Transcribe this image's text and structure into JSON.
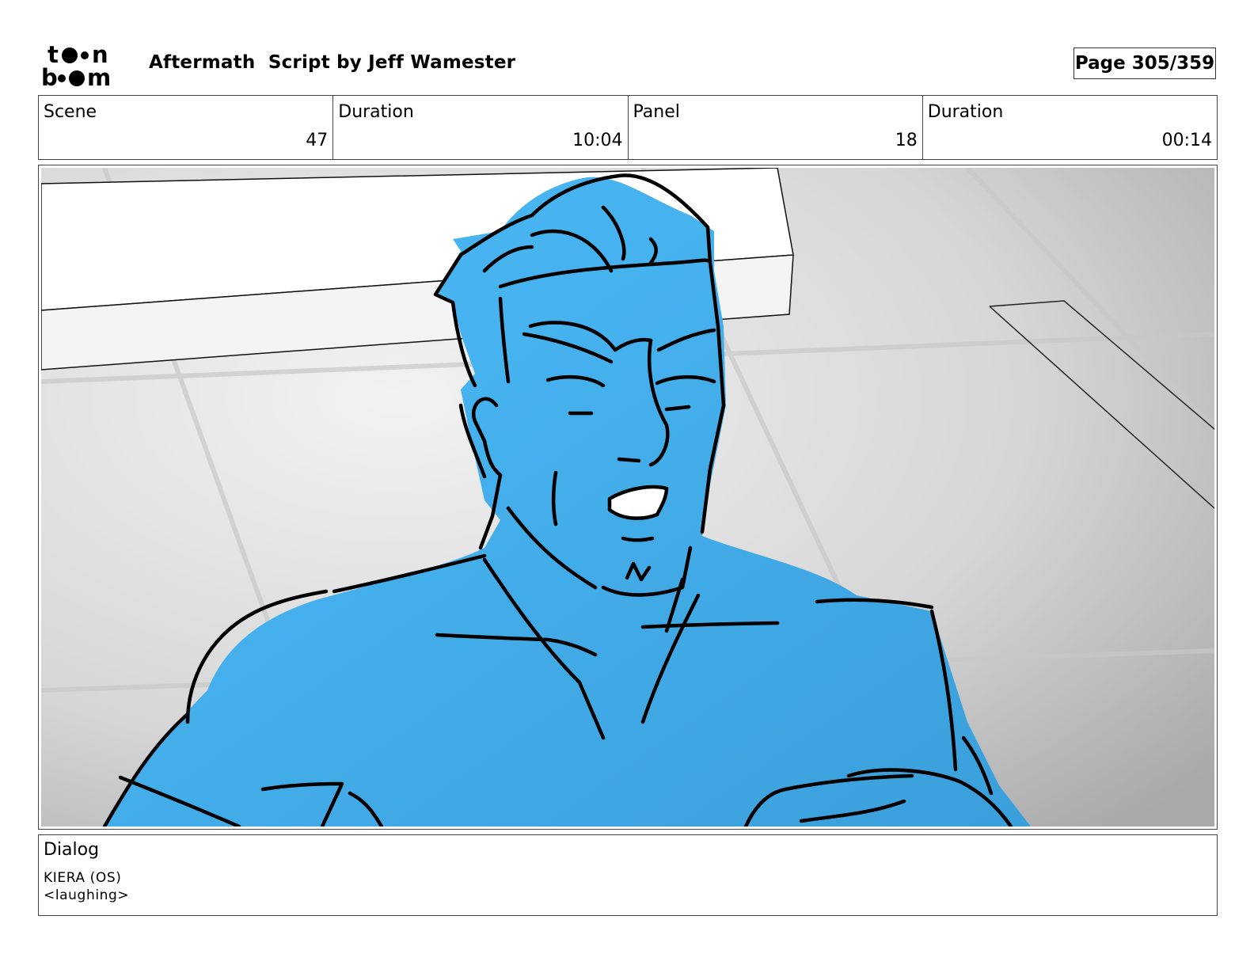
{
  "header": {
    "logo_text": "toon boom",
    "title": "Aftermath  Script by Jeff Wamester",
    "page": "Page 305/359"
  },
  "info": {
    "scene_label": "Scene",
    "scene_value": "47",
    "scene_duration_label": "Duration",
    "scene_duration_value": "10:04",
    "panel_label": "Panel",
    "panel_value": "18",
    "panel_duration_label": "Duration",
    "panel_duration_value": "00:14"
  },
  "panel": {
    "fill_color": "#46b8f8",
    "background_color": "#d9d9d9"
  },
  "dialog": {
    "label": "Dialog",
    "speaker": "KIERA (OS)",
    "line": "<laughing>"
  }
}
